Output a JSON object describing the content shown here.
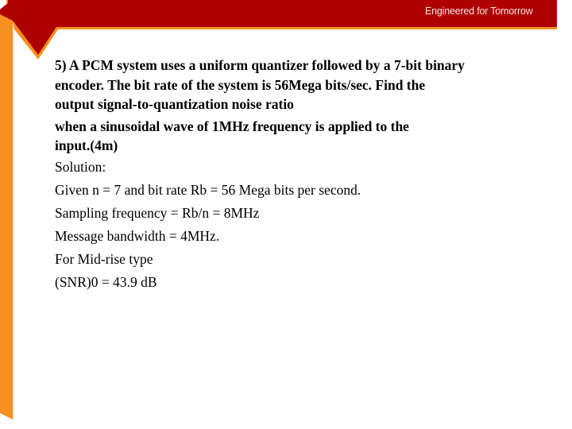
{
  "header": {
    "tagline": "Engineered for Tomorrow",
    "colors": {
      "band_red": "#ae0000",
      "accent_orange": "#f7901e"
    }
  },
  "question": {
    "paragraph1": [
      "5) A PCM system uses a uniform quantizer followed by a 7-bit binary",
      "encoder. The bit rate of the system is 56Mega bits/sec. Find the",
      "output signal-to-quantization noise ratio"
    ],
    "paragraph2": [
      "when a sinusoidal wave of 1MHz frequency is applied to the",
      "input.(4m)"
    ]
  },
  "solution": {
    "heading": "Solution:",
    "lines": [
      "Given n = 7 and bit rate Rb = 56 Mega bits per second.",
      "Sampling frequency = Rb/n = 8MHz",
      "Message bandwidth = 4MHz.",
      "For Mid-rise type",
      "(SNR)0 = 43.9 dB"
    ]
  }
}
